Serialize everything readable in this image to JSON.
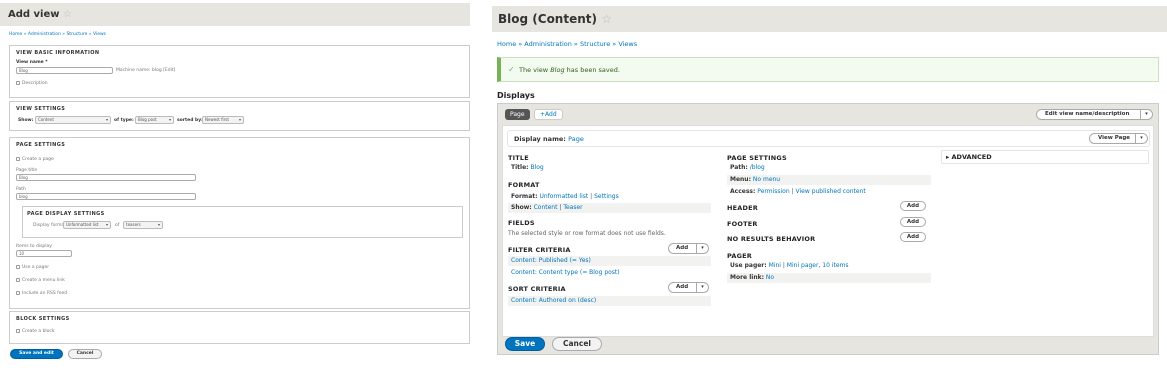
{
  "left": {
    "title": "Add view",
    "star": "☆",
    "breadcrumb": "Home » Administration » Structure » Views",
    "basic": {
      "legend": "VIEW BASIC INFORMATION",
      "view_name_label": "View name *",
      "view_name_value": "Blog",
      "machine_name": "Machine name: blog [Edit]",
      "description_label": "Description"
    },
    "settings": {
      "legend": "VIEW SETTINGS",
      "show_label": "Show:",
      "show_value": "Content",
      "of_type_label": "of type:",
      "of_type_value": "Blog post",
      "sorted_by_label": "sorted by:",
      "sorted_by_value": "Newest first"
    },
    "page": {
      "legend": "PAGE SETTINGS",
      "create_page": "Create a page",
      "page_title_label": "Page title",
      "page_title_value": "Blog",
      "path_label": "Path",
      "path_value": "blog",
      "display_legend": "PAGE DISPLAY SETTINGS",
      "display_format_label": "Display format:",
      "display_format_value": "Unformatted list",
      "of_label": "of",
      "of_value": "teasers",
      "items_label": "Items to display",
      "items_value": "10",
      "use_pager": "Use a pager",
      "menu_link": "Create a menu link",
      "rss_feed": "Include an RSS feed"
    },
    "block": {
      "legend": "BLOCK SETTINGS",
      "create_block": "Create a block"
    },
    "save_edit": "Save and edit",
    "cancel": "Cancel"
  },
  "right": {
    "title": "Blog (Content)",
    "star": "☆",
    "breadcrumb": "Home » Administration » Structure » Views",
    "message_pre": "The view ",
    "message_em": "Blog",
    "message_post": " has been saved.",
    "displays_title": "Displays",
    "tab_page": "Page",
    "tab_add": "+Add",
    "edit_view_btn": "Edit view name/description",
    "display_name_label": "Display name:",
    "display_name_value": "Page",
    "view_page_btn": "View Page",
    "title_section": {
      "heading": "TITLE",
      "label": "Title:",
      "value": "Blog"
    },
    "format_section": {
      "heading": "FORMAT",
      "format_label": "Format:",
      "format_value": "Unformatted list",
      "settings": "Settings",
      "show_label": "Show:",
      "show_value": "Content",
      "teaser": "Teaser"
    },
    "fields_section": {
      "heading": "FIELDS",
      "note": "The selected style or row format does not use fields."
    },
    "filter_section": {
      "heading": "FILTER CRITERIA",
      "add": "Add",
      "items": [
        "Content: Published (= Yes)",
        "Content: Content type (= Blog post)"
      ]
    },
    "sort_section": {
      "heading": "SORT CRITERIA",
      "add": "Add",
      "items": [
        "Content: Authored on (desc)"
      ]
    },
    "page_settings": {
      "heading": "PAGE SETTINGS",
      "path_label": "Path:",
      "path_value": "/blog",
      "menu_label": "Menu:",
      "menu_value": "No menu",
      "access_label": "Access:",
      "access_value": "Permission",
      "access_link": "View published content"
    },
    "header": {
      "heading": "HEADER",
      "add": "Add"
    },
    "footer": {
      "heading": "FOOTER",
      "add": "Add"
    },
    "no_results": {
      "heading": "NO RESULTS BEHAVIOR",
      "add": "Add"
    },
    "pager": {
      "heading": "PAGER",
      "use_pager_label": "Use pager:",
      "use_pager_value": "Mini",
      "pager_detail": "Mini pager, 10 items",
      "more_link_label": "More link:",
      "more_link_value": "No"
    },
    "advanced": "ADVANCED",
    "save": "Save",
    "cancel": "Cancel",
    "colors": {
      "primary": "#0074bd",
      "success": "#77b259",
      "bar": "#e6e5df"
    }
  }
}
